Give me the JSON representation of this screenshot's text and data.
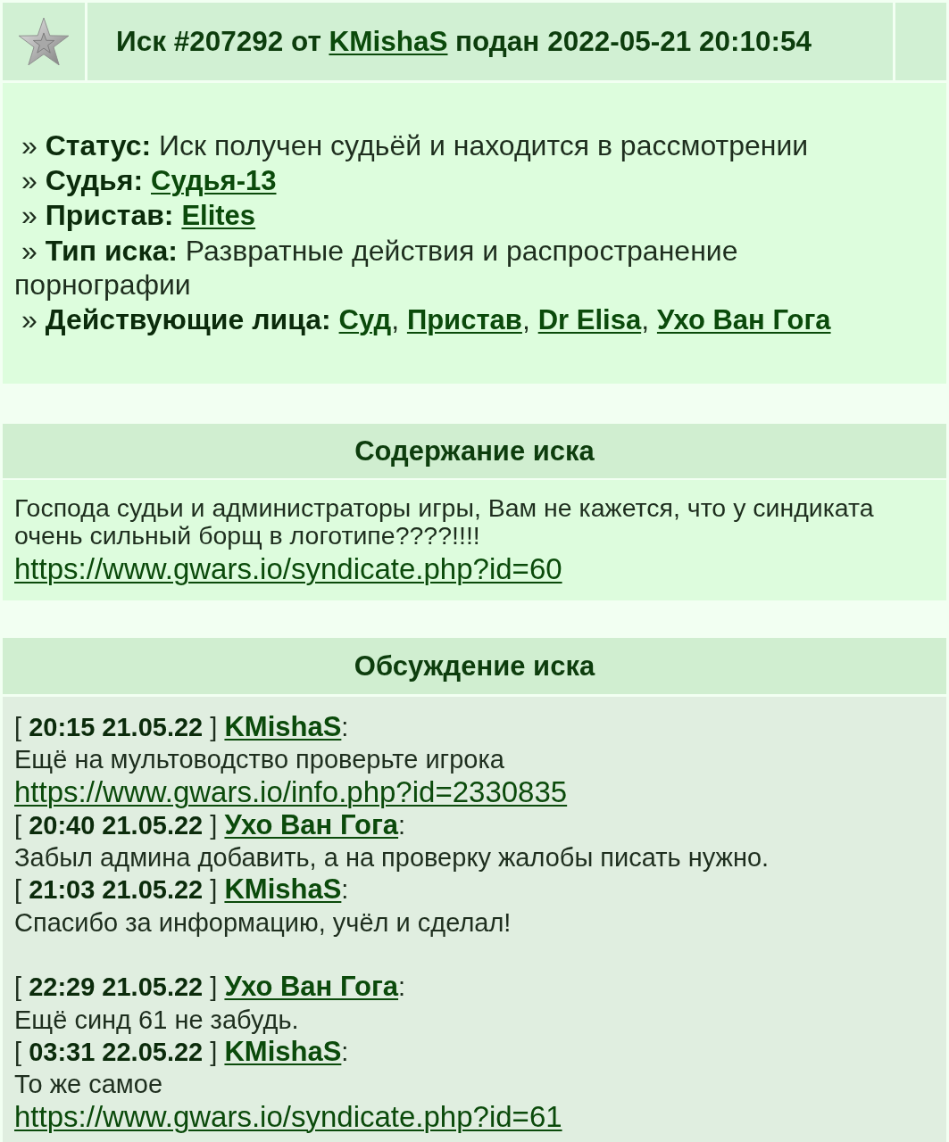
{
  "header": {
    "title_before": "Иск #207292 от",
    "author": "KMishaS",
    "title_after": "подан 2022-05-21 20:10:54"
  },
  "details": [
    {
      "kind": "text",
      "text": "» **Статус:** Иск получен судьёй и находится в рассмотрении"
    },
    {
      "kind": "links",
      "label": "» **Судья:**",
      "links": [
        {
          "text": "Судья-13"
        }
      ]
    },
    {
      "kind": "links",
      "label": "» **Пристав:**",
      "links": [
        {
          "text": "Elites"
        }
      ]
    },
    {
      "kind": "text",
      "text": "» **Тип иска:** Развратные действия и распространение порнографии"
    },
    {
      "kind": "links",
      "label": "» **Действующие лица:**",
      "links": [
        {
          "text": "Суд",
          "suffix": ","
        },
        {
          "text": "Пристав",
          "suffix": ","
        },
        {
          "text": "Dr Elisa",
          "suffix": ","
        },
        {
          "text": "Ухо Ван Гога"
        }
      ]
    }
  ],
  "content": {
    "title": "Содержание иска",
    "text": "Господа судьи и администраторы игры, Вам не кажется, что у синдиката очень сильный борщ в логотипе????!!!!",
    "link": "https://www.gwars.io/syndicate.php?id=60"
  },
  "discussion": {
    "title": "Обсуждение иска",
    "comments": [
      {
        "timestamp": "[ **20:15 21.05.22** ]",
        "author": "KMishaS",
        "colon": ":",
        "text": "Ещё на мультоводство проверьте игрока",
        "link": "https://www.gwars.io/info.php?id=2330835",
        "blank_line_after": false
      },
      {
        "timestamp": "[ **20:40 21.05.22** ]",
        "author": "Ухо Ван Гога",
        "colon": ":",
        "text": "Забыл админа добавить, а на проверку жалобы писать нужно.",
        "blank_line_after": false
      },
      {
        "timestamp": "[ **21:03 21.05.22** ]",
        "author": "KMishaS",
        "colon": ":",
        "text": "Спасибо за информацию, учёл и сделал!",
        "blank_line_after": true
      },
      {
        "timestamp": "[ **22:29 21.05.22** ]",
        "author": "Ухо Ван Гога",
        "colon": ":",
        "text": "Ещё синд 61 не забудь.",
        "blank_line_after": false
      },
      {
        "timestamp": "[ **03:31 22.05.22** ]",
        "author": "KMishaS",
        "colon": ":",
        "text": "То же самое",
        "link": "https://www.gwars.io/syndicate.php?id=61",
        "blank_line_after": false
      }
    ]
  }
}
